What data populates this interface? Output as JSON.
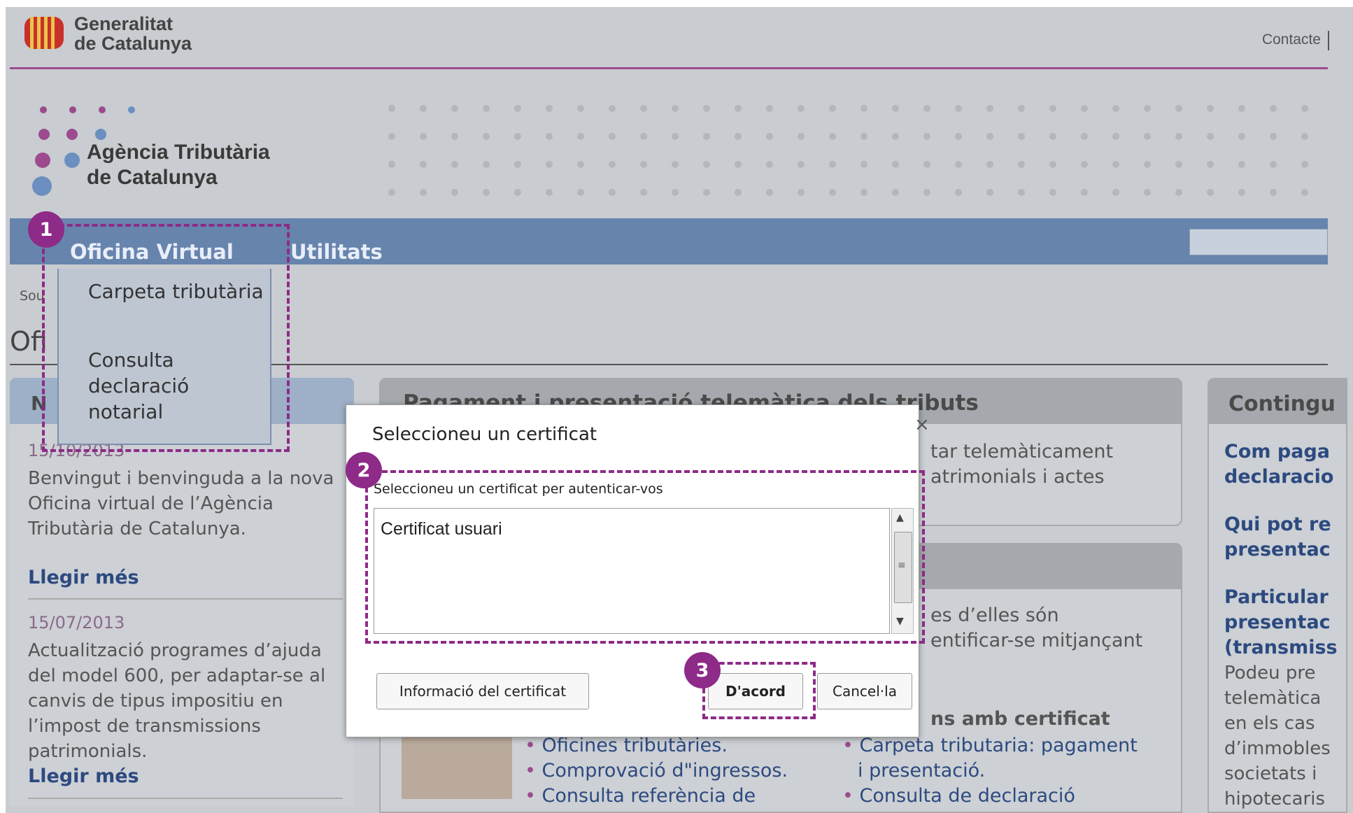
{
  "header": {
    "org_line1": "Generalitat",
    "org_line2": "de Catalunya",
    "contact": "Contacte"
  },
  "agency": {
    "line1": "Agència Tributària",
    "line2": "de Catalunya"
  },
  "nav": {
    "items": [
      {
        "label": "Oficina Virtual"
      },
      {
        "label": "Utilitats"
      }
    ],
    "dropdown": [
      {
        "label": "Carpeta tributària"
      },
      {
        "label": "Consulta declaració notarial"
      }
    ]
  },
  "page": {
    "breadcrumb_partial": "Sou",
    "heading_partial": "Ofi"
  },
  "news": {
    "header_partial": "N",
    "items": [
      {
        "date": "15/10/2013",
        "text": "Benvingut i benvinguda a la nova Oficina virtual de l’Agència Tributària de Catalunya.",
        "link": "Llegir més"
      },
      {
        "date": "15/07/2013",
        "text": "Actualització programes d’ajuda del model 600, per adaptar-se al canvis de tipus impositiu en l’impost de transmissions patrimonials.",
        "link": "Llegir més"
      }
    ]
  },
  "middle": {
    "panel1_title": "Pagament i presentació telemàtica dels tributs",
    "panel1_line1": "tar telemàticament",
    "panel1_line2": "atrimonials i actes",
    "panel2_line1": "es d’elles són",
    "panel2_line2": "entificar-se mitjançant",
    "panel2_bold": "ns amb certificat",
    "list_left": [
      "Oficines tributàries.",
      "Comprovació d\"ingressos.",
      "Consulta referència de"
    ],
    "list_right_1": "Carpeta tributaria: pagament",
    "list_right_1b": "i presentació.",
    "list_right_2": "Consulta de declaració"
  },
  "right": {
    "header_partial": "Contingu",
    "link1a": "Com paga",
    "link1b": "declaracio",
    "link2a": "Qui pot re",
    "link2b": "presentac",
    "link3a": "Particular",
    "link3b": "presentac",
    "link3c": "(transmiss",
    "text": [
      "Podeu pre",
      "telemàtica",
      "en els cas",
      "d’immobles",
      "societats i",
      "hipotecaris"
    ]
  },
  "dialog": {
    "title": "Seleccioneu un certificat",
    "close": "×",
    "instruction": "Seleccioneu un certificat per autenticar-vos",
    "certificates": [
      "Certificat usuari"
    ],
    "btn_info": "Informació del certificat",
    "btn_ok": "D'acord",
    "btn_cancel": "Cancel·la"
  },
  "steps": [
    "1",
    "2",
    "3"
  ],
  "colors": {
    "accent": "#8e2a88",
    "nav": "#6784ad",
    "link": "#2c4a80",
    "header_rule": "#9c4b8e"
  }
}
